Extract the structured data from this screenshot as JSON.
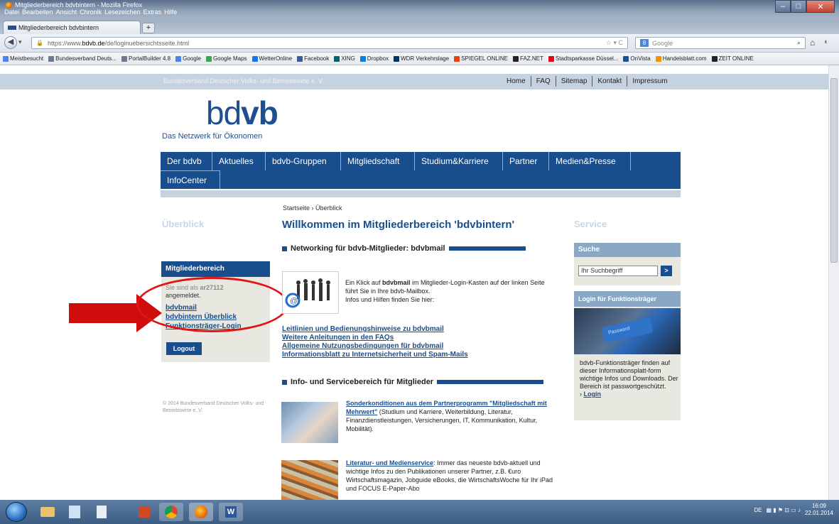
{
  "window": {
    "title": "Mitgliederbereich bdvbintern - Mozilla Firefox",
    "menu": [
      "Datei",
      "Bearbeiten",
      "Ansicht",
      "Chronik",
      "Lesezeichen",
      "Extras",
      "Hilfe"
    ]
  },
  "tab": {
    "label": "Mitgliederbereich bdvbintern"
  },
  "nav": {
    "url_prefix": "https://www.",
    "url_domain": "bdvb.de",
    "url_path": "/de/loginuebersichtsseite.html",
    "search_placeholder": "Google"
  },
  "bookmarks": [
    {
      "label": "Meistbesucht",
      "color": "#4a86e8"
    },
    {
      "label": "Bundesverband Deuts...",
      "color": "#6b7b8c"
    },
    {
      "label": "PortalBuilder 4.8",
      "color": "#6b7b8c"
    },
    {
      "label": "Google",
      "color": "#4a86e8"
    },
    {
      "label": "Google Maps",
      "color": "#34a853"
    },
    {
      "label": "WetterOnline",
      "color": "#1a73e8"
    },
    {
      "label": "Facebook",
      "color": "#3b5998"
    },
    {
      "label": "XING",
      "color": "#026466"
    },
    {
      "label": "Dropbox",
      "color": "#007ee5"
    },
    {
      "label": "WDR Verkehrslage",
      "color": "#00345e"
    },
    {
      "label": "SPIEGEL ONLINE",
      "color": "#e64415"
    },
    {
      "label": "FAZ.NET",
      "color": "#222222"
    },
    {
      "label": "Stadtsparkasse Düssel...",
      "color": "#e2001a"
    },
    {
      "label": "OnVista",
      "color": "#1d4f91"
    },
    {
      "label": "Handelsblatt.com",
      "color": "#f39200"
    },
    {
      "label": "ZEIT ONLINE",
      "color": "#222222"
    }
  ],
  "site": {
    "org_name": "Bundesverband Deutscher Volks- und Betriebswirte e. V.",
    "top_links": [
      "Home",
      "FAQ",
      "Sitemap",
      "Kontakt",
      "Impressum"
    ],
    "logo_light": "bd",
    "logo_bold": "vb",
    "tagline": "Das Netzwerk für Ökonomen",
    "main_nav": [
      "Der bdvb",
      "Aktuelles",
      "bdvb-Gruppen",
      "Mitgliedschaft",
      "Studium&Karriere",
      "Partner",
      "Medien&Presse",
      "InfoCenter"
    ],
    "breadcrumb": "Startseite › Überblick",
    "left_heading": "Überblick",
    "main_heading": "Willkommen im Mitgliederbereich 'bdvbintern'",
    "right_heading": "Service"
  },
  "member_box": {
    "title": "Mitgliederbereich",
    "status_line1": "Sie sind als ",
    "status_user": "ar27112",
    "status_line2": "angemeldet.",
    "links": [
      "bdvbmail",
      "bdvbintern Überblick",
      "Funktionsträger-Login"
    ],
    "logout": "Logout",
    "copyright": "© 2014 Bundesverband Deutscher Volks- und Betriebswirte e. V."
  },
  "networking": {
    "heading": "Networking für bdvb-Mitglieder: bdvbmail",
    "text1": "Ein Klick auf ",
    "text_bold": "bdvbmail",
    "text2": " im Mitglieder-Login-Kasten auf der linken Seite führt Sie in Ihre bdvb-Mailbox.",
    "text3": "Infos und Hilfen finden Sie hier:",
    "links": [
      "Leitlinien und Bedienungshinweise zu bdvbmail",
      "Weitere Anleitungen in den FAQs",
      "Allgemeine Nutzungsbedingungen für bdvbmail",
      "Informationsblatt zu Internetsicherheit und Spam-Mails"
    ]
  },
  "info": {
    "heading": "Info- und Servicebereich für Mitglieder",
    "item1_title": "Sonderkonditionen aus dem Partnerprogramm \"Mitgliedschaft mit Mehrwert\"",
    "item1_text": " (Studium und Karriere, Weiterbildung, Literatur, Finanzdienstleistungen, Versicherungen, IT, Kommunikation, Kultur, Mobilität).",
    "item2_title": "Literatur- und Medienservice",
    "item2_text": ": Immer das neueste bdvb-aktuell und wichtige Infos zu den Publikationen unserer Partner, z.B. €uro Wirtschaftsmagazin, Jobguide eBooks, die WirtschaftsWoche für Ihr iPad und FOCUS E-Paper-Abo"
  },
  "service": {
    "search_title": "Suche",
    "search_value": "Ihr Suchbegriff",
    "search_go": ">",
    "funk_title": "Login für Funktionsträger",
    "funk_image_label": "Password",
    "funk_text": "bdvb-Funktionsträger finden auf dieser Informationsplatt-form wichtige Infos und Downloads. Der Bereich ist passwortgeschützt.",
    "funk_login": "Login"
  },
  "taskbar": {
    "language": "DE",
    "time": "16:09",
    "date": "22.01.2014"
  }
}
